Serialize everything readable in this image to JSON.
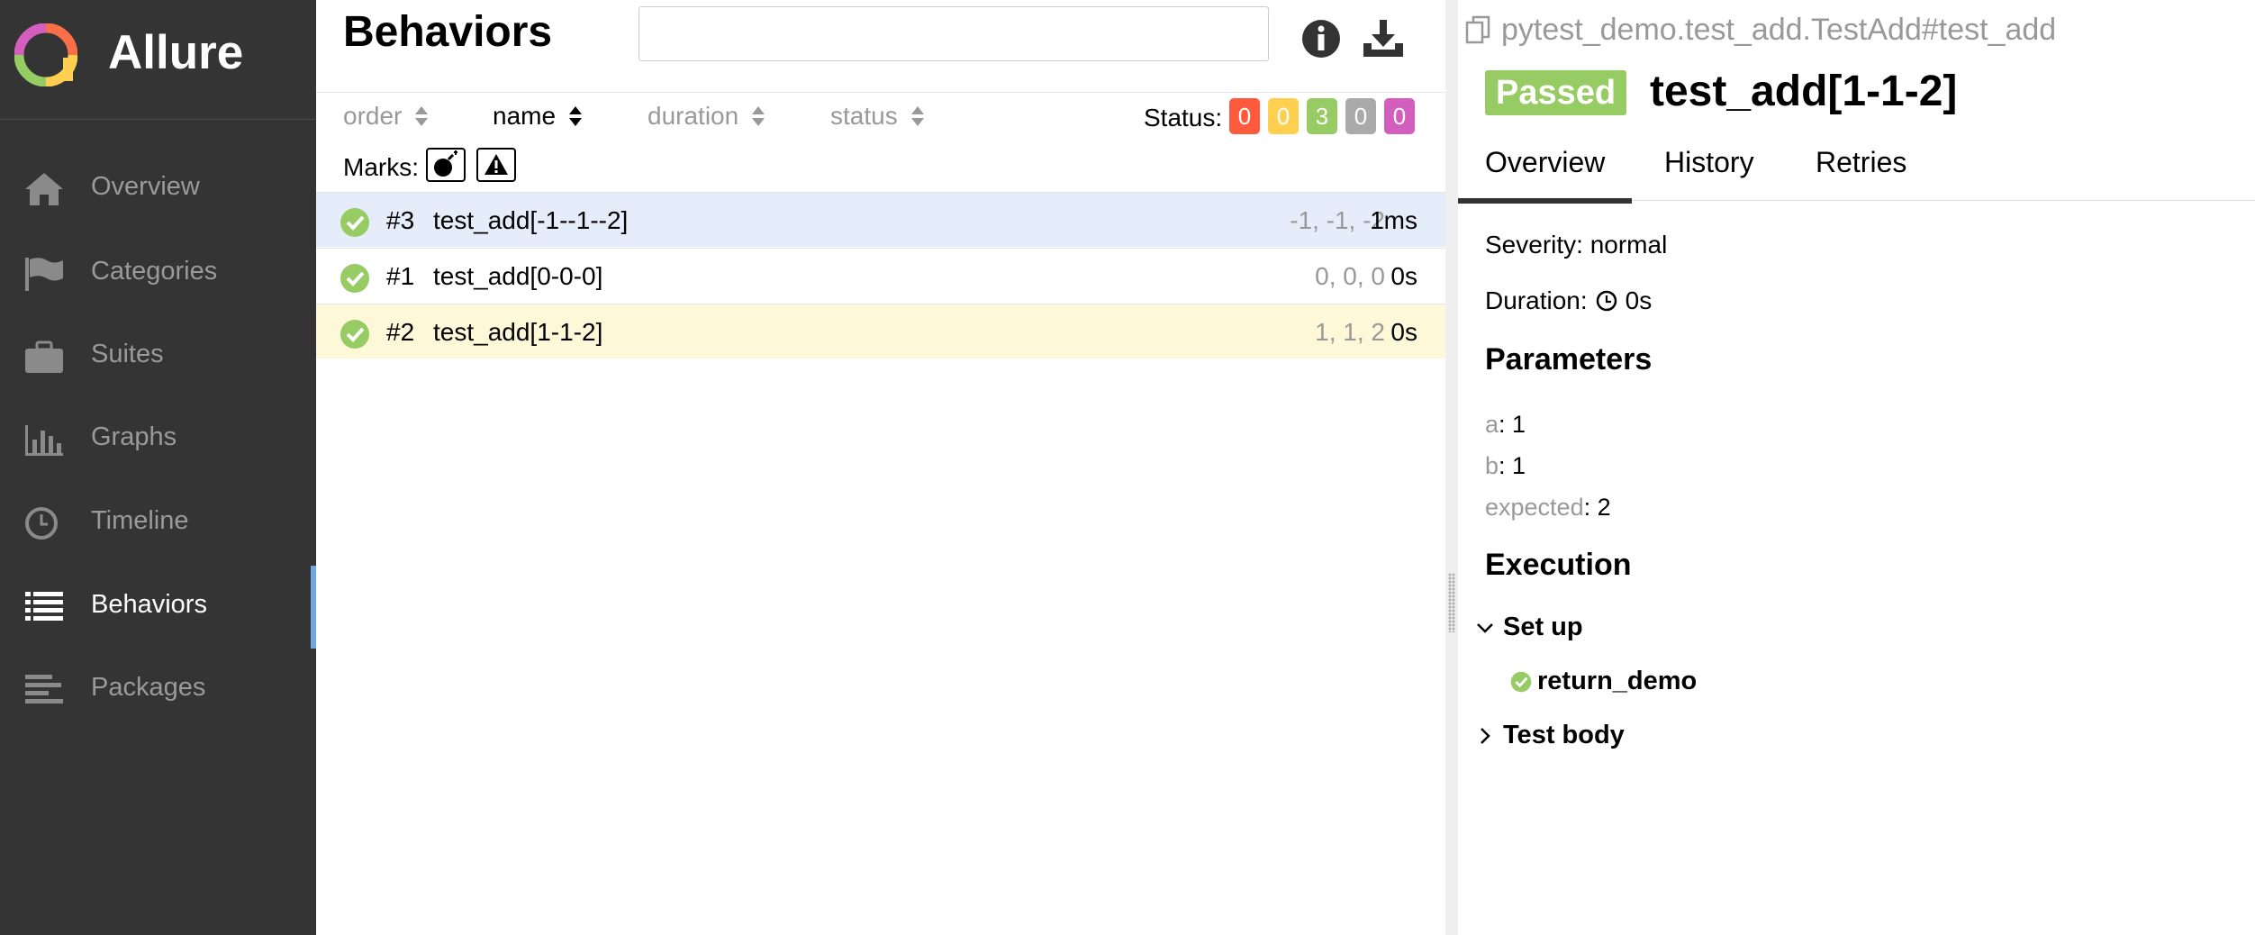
{
  "sidebar": {
    "brand": "Allure",
    "items": [
      {
        "label": "Overview",
        "icon": "home-icon"
      },
      {
        "label": "Categories",
        "icon": "flag-icon"
      },
      {
        "label": "Suites",
        "icon": "briefcase-icon"
      },
      {
        "label": "Graphs",
        "icon": "bar-chart-icon"
      },
      {
        "label": "Timeline",
        "icon": "clock-icon"
      },
      {
        "label": "Behaviors",
        "icon": "list-icon",
        "active": true
      },
      {
        "label": "Packages",
        "icon": "align-left-icon"
      }
    ]
  },
  "tree": {
    "title": "Behaviors",
    "search": {
      "value": "",
      "placeholder": ""
    },
    "sort": {
      "order": "order",
      "name": "name",
      "duration": "duration",
      "status": "status"
    },
    "status_label": "Status:",
    "status_counts": {
      "failed": "0",
      "broken": "0",
      "passed": "3",
      "skipped": "0",
      "unknown": "0"
    },
    "marks_label": "Marks:",
    "rows": [
      {
        "num": "#3",
        "name": "test_add[-1--1--2]",
        "params": "-1, -1, -2",
        "duration": "1ms"
      },
      {
        "num": "#1",
        "name": "test_add[0-0-0]",
        "params": "0, 0, 0",
        "duration": "0s"
      },
      {
        "num": "#2",
        "name": "test_add[1-1-2]",
        "params": "1, 1, 2",
        "duration": "0s"
      }
    ]
  },
  "detail": {
    "breadcrumb": "pytest_demo.test_add.TestAdd#test_add",
    "status": "Passed",
    "title": "test_add[1-1-2]",
    "tabs": [
      "Overview",
      "History",
      "Retries"
    ],
    "severity": "Severity: normal",
    "duration_label": "Duration:",
    "duration_value": "0s",
    "parameters_heading": "Parameters",
    "parameters": [
      {
        "key": "a",
        "value": "1"
      },
      {
        "key": "b",
        "value": "1"
      },
      {
        "key": "expected",
        "value": "2"
      }
    ],
    "execution_heading": "Execution",
    "setup_label": "Set up",
    "setup_step": "return_demo",
    "body_label": "Test body"
  },
  "colors": {
    "sidebar": "#343434",
    "passed": "#97cc64",
    "failed": "#fd5a3e",
    "broken": "#ffd050",
    "skipped": "#aaaaaa",
    "unknown": "#d35ebe",
    "active_row": "#e6edfa",
    "hover_row": "#fdf8d8"
  }
}
